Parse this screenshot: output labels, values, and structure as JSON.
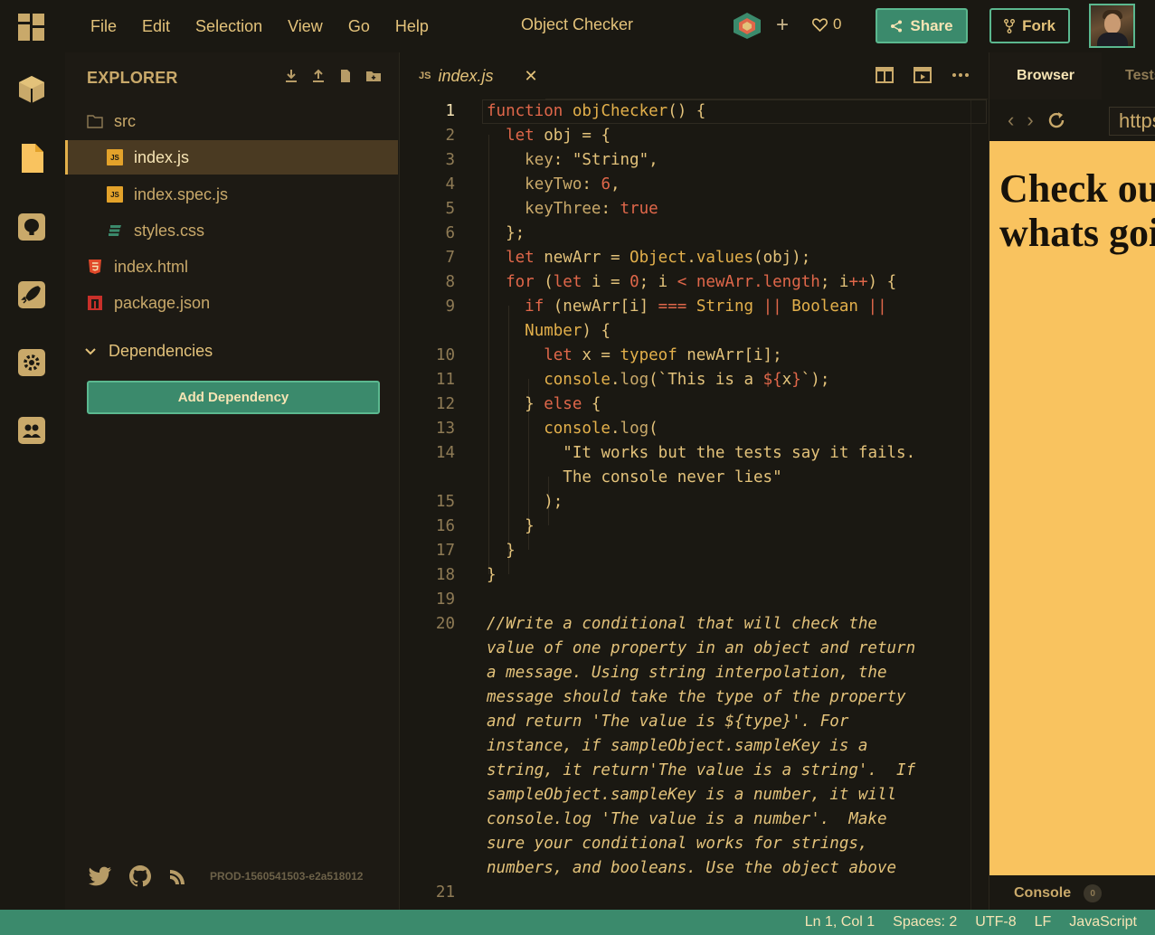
{
  "menu": {
    "items": [
      "File",
      "Edit",
      "Selection",
      "View",
      "Go",
      "Help"
    ],
    "title": "Object Checker",
    "like_count": "0",
    "share_label": "Share",
    "fork_label": "Fork"
  },
  "activity_icons": [
    "cube-icon",
    "file-icon",
    "github-icon",
    "rocket-icon",
    "gear-icon",
    "users-icon"
  ],
  "explorer": {
    "heading": "EXPLORER",
    "files": [
      {
        "name": "src",
        "icon": "folder-icon"
      },
      {
        "name": "index.js",
        "icon": "js-icon",
        "active": true
      },
      {
        "name": "index.spec.js",
        "icon": "js-icon"
      },
      {
        "name": "styles.css",
        "icon": "css-icon"
      },
      {
        "name": "index.html",
        "icon": "html-icon"
      },
      {
        "name": "package.json",
        "icon": "npm-icon"
      }
    ],
    "dependencies_label": "Dependencies",
    "add_dependency_label": "Add Dependency",
    "build_id": "PROD-1560541503-e2a518012"
  },
  "editor": {
    "tab_badge": "JS",
    "tab_name": "index.js",
    "line_numbers": [
      "1",
      "2",
      "3",
      "4",
      "5",
      "6",
      "7",
      "8",
      "9",
      "10",
      "11",
      "12",
      "13",
      "14",
      "15",
      "16",
      "17",
      "18",
      "19",
      "20",
      "21"
    ],
    "comment_lines": [
      "//Write a conditional that will check the",
      "value of one property in an object and return",
      "a message. Using string interpolation, the",
      "message should take the type of the property",
      "and return 'The value is ${type}'. For",
      "instance, if sampleObject.sampleKey is a",
      "string, it return'The value is a string'.  If",
      "sampleObject.sampleKey is a number, it will",
      "console.log 'The value is a number'.  Make",
      "sure your conditional works for strings,",
      "numbers, and booleans. Use the object above"
    ]
  },
  "preview": {
    "tab_browser": "Browser",
    "tab_tests": "Tests",
    "url": "https://",
    "heading_line1": "Check out",
    "heading_line2": "whats going",
    "console_label": "Console",
    "console_count": "0"
  },
  "status": {
    "position": "Ln 1, Col 1",
    "spaces": "Spaces: 2",
    "encoding": "UTF-8",
    "eol": "LF",
    "language": "JavaScript"
  },
  "colors": {
    "accent": "#3b8a6c",
    "text": "#e3c27a",
    "preview_bg": "#f9c35f"
  }
}
